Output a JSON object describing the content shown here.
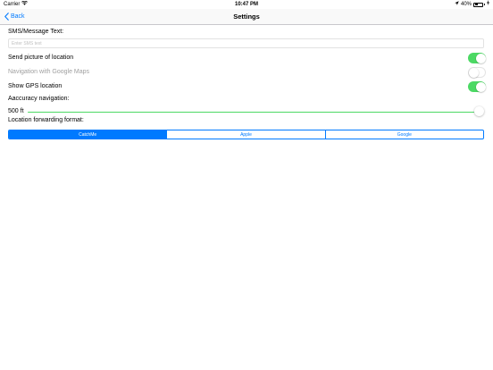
{
  "status_bar": {
    "carrier": "Carrier",
    "time": "10:47 PM",
    "battery": "40%"
  },
  "nav": {
    "back_label": "Back",
    "title": "Settings"
  },
  "settings": {
    "sms_label": "SMS/Message Text:",
    "sms_placeholder": "Enter SMS text",
    "sms_value": "",
    "send_picture_label": "Send picture of location",
    "send_picture_on": true,
    "google_maps_label": "Navigation with Google Maps",
    "google_maps_on": false,
    "show_gps_label": "Show GPS location",
    "show_gps_on": true,
    "accuracy_label": "Aaccuracy navigation:",
    "accuracy_value": "500 ft",
    "accuracy_fraction": 1.0,
    "format_label": "Location forwarding format:",
    "format_options": [
      "CatchMe",
      "Apple",
      "Google"
    ],
    "format_selected": "CatchMe"
  },
  "colors": {
    "accent": "#007aff",
    "switch_on": "#4cd964"
  }
}
